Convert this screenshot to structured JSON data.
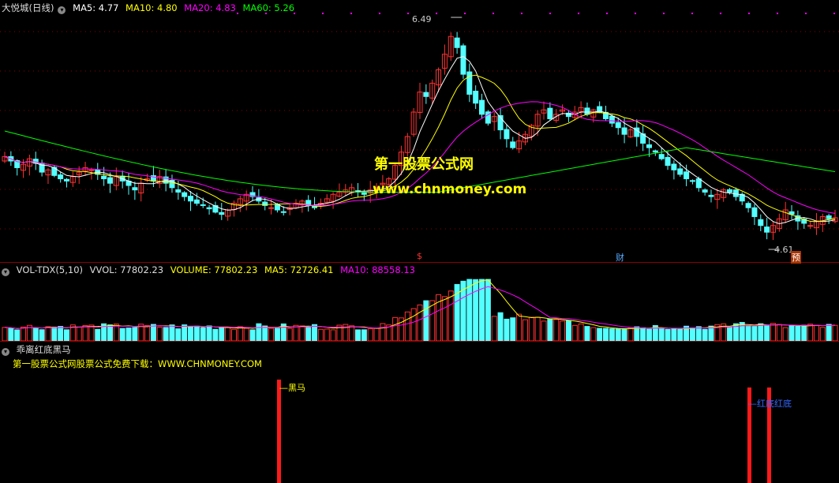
{
  "colors": {
    "up": "#ff3232",
    "down": "#54ffff",
    "ma5": "#ffffff",
    "ma10": "#ffff00",
    "ma20": "#ff00ff",
    "ma60": "#00ff00",
    "grid": "#8b0000",
    "hdr_yellow": "#ffff00"
  },
  "main": {
    "title": "大悦城(日线)",
    "ma5": "MA5: 4.77",
    "ma10": "MA10: 4.80",
    "ma20": "MA20: 4.83",
    "ma60": "MA60: 5.26",
    "high_label": "6.49",
    "low_label": "4.61",
    "marker_s": "$",
    "marker_cai": "财",
    "marker_yu": "预"
  },
  "watermark": {
    "line1": "第一股票公式网",
    "line2": "www.chnmoney.com"
  },
  "volume": {
    "title": "VOL-TDX(5,10)",
    "vvol": "VVOL: 77802.23",
    "volume": "VOLUME: 77802.23",
    "ma5": "MA5: 72726.41",
    "ma10": "MA10: 88558.13"
  },
  "indicator": {
    "title": "乖离红底黑马",
    "promo": "第一股票公式网股票公式免费下载：WWW.CHNMONEY.COM",
    "label_heima": "黑马",
    "label_hongdi": "红底红底"
  },
  "chart_data": {
    "type": "candlestick",
    "price_range": [
      4.4,
      6.6
    ],
    "closes": [
      5.32,
      5.28,
      5.22,
      5.25,
      5.3,
      5.26,
      5.18,
      5.2,
      5.15,
      5.12,
      5.1,
      5.14,
      5.18,
      5.22,
      5.2,
      5.16,
      5.12,
      5.08,
      5.14,
      5.1,
      5.06,
      5.02,
      5.08,
      5.12,
      5.1,
      5.14,
      5.08,
      5.04,
      5.0,
      4.96,
      4.92,
      4.9,
      4.88,
      4.85,
      4.82,
      4.8,
      4.84,
      4.9,
      4.94,
      4.98,
      4.96,
      4.92,
      4.88,
      4.86,
      4.84,
      4.82,
      4.86,
      4.9,
      4.92,
      4.88,
      4.86,
      4.9,
      4.94,
      4.98,
      5.0,
      5.02,
      5.04,
      5.0,
      4.98,
      5.02,
      5.04,
      5.08,
      5.12,
      5.24,
      5.36,
      5.5,
      5.72,
      5.9,
      5.86,
      5.98,
      6.1,
      6.24,
      6.4,
      6.3,
      6.06,
      5.88,
      5.8,
      5.7,
      5.62,
      5.68,
      5.56,
      5.48,
      5.4,
      5.46,
      5.52,
      5.6,
      5.7,
      5.74,
      5.66,
      5.7,
      5.74,
      5.68,
      5.72,
      5.76,
      5.7,
      5.74,
      5.72,
      5.66,
      5.62,
      5.58,
      5.52,
      5.56,
      5.5,
      5.44,
      5.4,
      5.36,
      5.3,
      5.24,
      5.2,
      5.16,
      5.12,
      5.1,
      5.04,
      5.0,
      4.96,
      4.98,
      5.02,
      5.0,
      4.96,
      4.92,
      4.86,
      4.78,
      4.7,
      4.64,
      4.7,
      4.76,
      4.84,
      4.8,
      4.74,
      4.72,
      4.7,
      4.74,
      4.78,
      4.76,
      4.77
    ]
  }
}
